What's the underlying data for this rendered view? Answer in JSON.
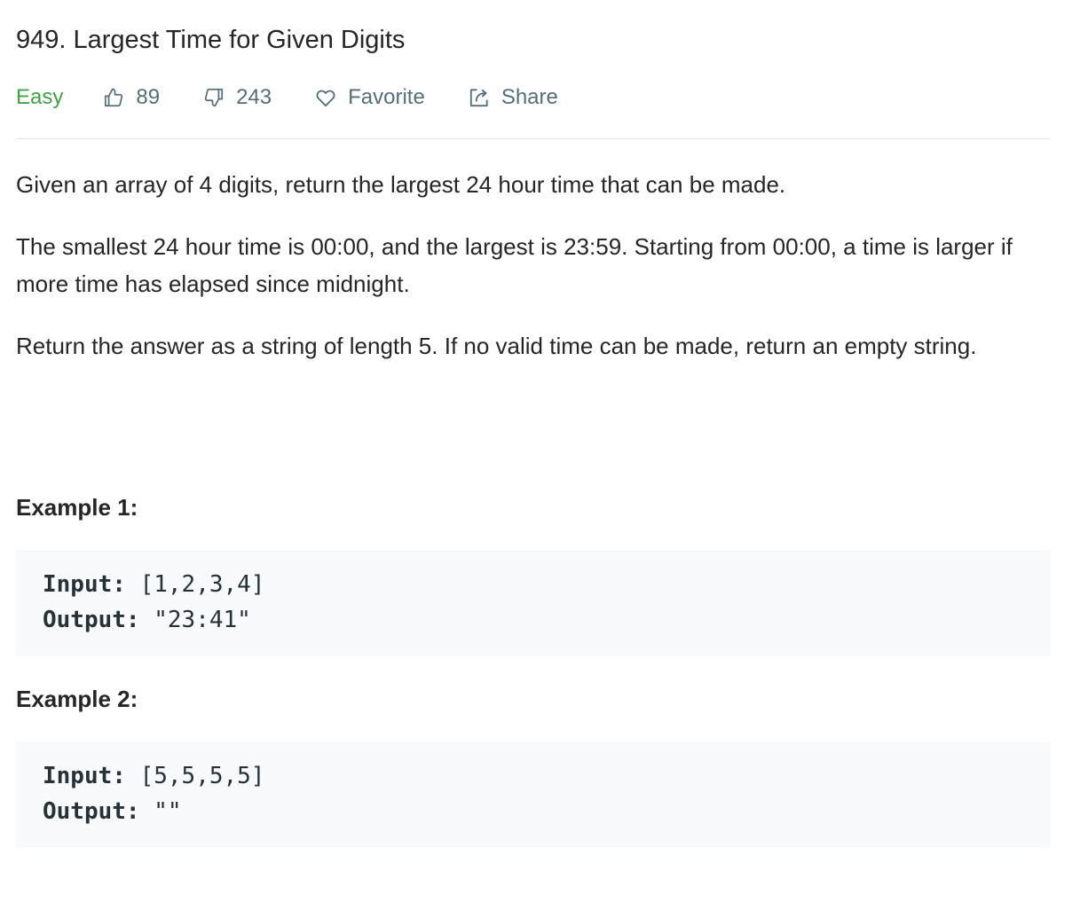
{
  "problem": {
    "title": "949. Largest Time for Given Digits",
    "difficulty": "Easy",
    "likes": "89",
    "dislikes": "243",
    "favorite_label": "Favorite",
    "share_label": "Share"
  },
  "description": {
    "paragraphs": [
      "Given an array of 4 digits, return the largest 24 hour time that can be made.",
      "The smallest 24 hour time is 00:00, and the largest is 23:59.  Starting from 00:00, a time is larger if more time has elapsed since midnight.",
      "Return the answer as a string of length 5.  If no valid time can be made, return an empty string."
    ]
  },
  "examples": [
    {
      "heading": "Example 1:",
      "input_label": "Input:",
      "input_value": " [1,2,3,4]",
      "output_label": "Output:",
      "output_value": " \"23:41\""
    },
    {
      "heading": "Example 2:",
      "input_label": "Input:",
      "input_value": " [5,5,5,5]",
      "output_label": "Output:",
      "output_value": " \"\""
    }
  ],
  "icons": {
    "thumbs_up": "thumbs-up-icon",
    "thumbs_down": "thumbs-down-icon",
    "heart": "heart-icon",
    "share": "share-icon"
  },
  "colors": {
    "difficulty_easy": "#43a047",
    "meta_text": "#546e7a",
    "text": "#262626",
    "code_background": "#f7f9fa"
  }
}
